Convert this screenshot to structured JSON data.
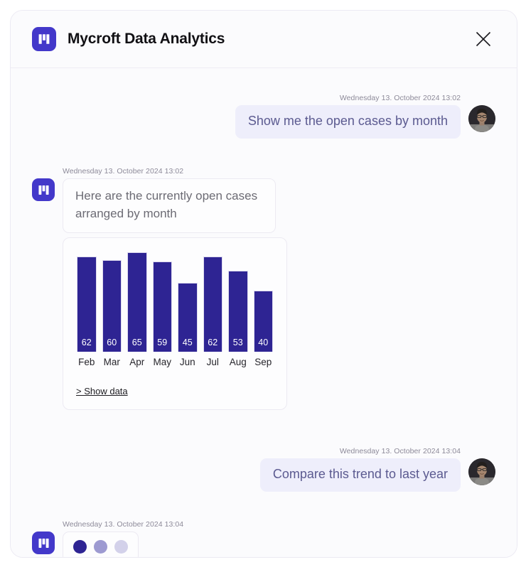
{
  "window": {
    "title": "Mycroft Data Analytics",
    "logo_icon": "mycroft-logo-icon",
    "close_icon": "close-icon",
    "accent_color": "#4338ca",
    "bar_color": "#2e2493",
    "user_bubble_bg": "#eeeefb",
    "user_bubble_text_color": "#5b5a90"
  },
  "messages": [
    {
      "role": "user",
      "timestamp": "Wednesday 13. October 2024 13:02",
      "text": "Show me the open cases by month"
    },
    {
      "role": "assistant",
      "timestamp": "Wednesday 13. October 2024 13:02",
      "text": "Here are the currently open cases arranged by month"
    },
    {
      "role": "user",
      "timestamp": "Wednesday 13. October 2024 13:04",
      "text": "Compare this trend to last year"
    },
    {
      "role": "assistant",
      "timestamp": "Wednesday 13. October 2024 13:04",
      "text": ""
    }
  ],
  "chart_card": {
    "show_data_label": "> Show data"
  },
  "chart_data": {
    "type": "bar",
    "title": "",
    "subtitle": "",
    "xlabel": "",
    "ylabel": "",
    "categories": [
      "Feb",
      "Mar",
      "Apr",
      "May",
      "Jun",
      "Jul",
      "Aug",
      "Sep"
    ],
    "values": [
      62,
      60,
      65,
      59,
      45,
      62,
      53,
      40
    ],
    "value_labels": [
      "62",
      "60",
      "65",
      "59",
      "45",
      "62",
      "53",
      "40"
    ],
    "ylim": [
      0,
      65
    ],
    "grid": false,
    "legend": false,
    "bar_color": "#2e2493",
    "value_label_color": "#ffffff"
  },
  "typing_indicator": {
    "dots": [
      "#2e2493",
      "#9d9ad1",
      "#d3d1ea"
    ]
  }
}
